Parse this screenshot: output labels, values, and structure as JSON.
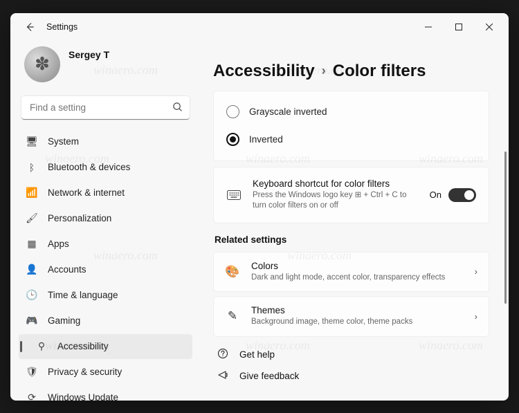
{
  "window": {
    "title": "Settings"
  },
  "profile": {
    "name": "Sergey T"
  },
  "search": {
    "placeholder": "Find a setting"
  },
  "sidebar": {
    "items": [
      {
        "label": "System",
        "icon": "🖥"
      },
      {
        "label": "Bluetooth & devices",
        "icon": "ᛒ"
      },
      {
        "label": "Network & internet",
        "icon": "📶"
      },
      {
        "label": "Personalization",
        "icon": "🖌"
      },
      {
        "label": "Apps",
        "icon": "▦"
      },
      {
        "label": "Accounts",
        "icon": "👤"
      },
      {
        "label": "Time & language",
        "icon": "🕒"
      },
      {
        "label": "Gaming",
        "icon": "🎮"
      },
      {
        "label": "Accessibility",
        "icon": "⚲"
      },
      {
        "label": "Privacy & security",
        "icon": "🛡"
      },
      {
        "label": "Windows Update",
        "icon": "⟳"
      }
    ],
    "active_index": 8
  },
  "breadcrumb": {
    "parent": "Accessibility",
    "current": "Color filters"
  },
  "filters": {
    "options": [
      {
        "label": "Grayscale inverted",
        "selected": false
      },
      {
        "label": "Inverted",
        "selected": true
      }
    ]
  },
  "shortcut": {
    "title": "Keyboard shortcut for color filters",
    "desc": "Press the Windows logo key ⊞ + Ctrl + C to turn color filters on or off",
    "state_label": "On",
    "on": true
  },
  "related": {
    "heading": "Related settings",
    "items": [
      {
        "title": "Colors",
        "desc": "Dark and light mode, accent color, transparency effects",
        "icon": "🎨"
      },
      {
        "title": "Themes",
        "desc": "Background image, theme color, theme packs",
        "icon": "✎"
      }
    ]
  },
  "footer": {
    "help": "Get help",
    "feedback": "Give feedback"
  },
  "watermark": "winaero.com"
}
